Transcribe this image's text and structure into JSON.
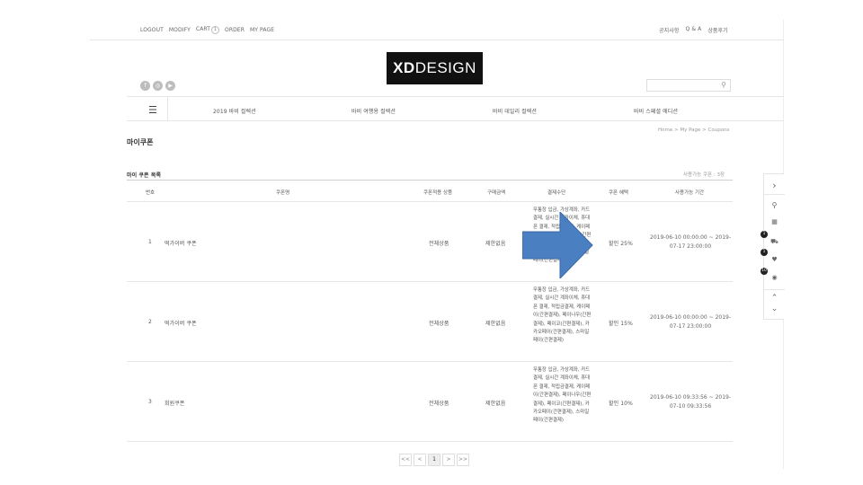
{
  "top_nav": {
    "logout": "LOGOUT",
    "modify": "MODIFY",
    "cart": "CART",
    "cart_count": "1",
    "order": "ORDER",
    "mypage": "MY PAGE"
  },
  "top_right": [
    "공지사항",
    "Q & A",
    "상품후기"
  ],
  "logo": {
    "bold": "XD",
    "light": "DESIGN"
  },
  "social": [
    "f",
    "◎",
    "▶"
  ],
  "categories": [
    "2019 바비 컬렉션",
    "바비 여행용 컬렉션",
    "바비 데일리 컬렉션",
    "바비 스페셜 에디션"
  ],
  "page_title": "마이쿠폰",
  "breadcrumb": "Home  >  My Page  >  Coupons",
  "list_title": "마이 쿠폰 목록",
  "available": "사용가능 쿠폰 : 3장",
  "headers": [
    "번호",
    "쿠폰명",
    "쿠폰적용 상품",
    "구매금액",
    "결제수단",
    "쿠폰 혜택",
    "사용가능 기간"
  ],
  "rows": [
    {
      "no": "1",
      "name": "떡가이버 쿠폰",
      "product": "전체상품",
      "amount": "제한없음",
      "payment": "무통장 입금, 가상계좌, 카드 결제, 실시간 계좌이체, 휴대폰 결제, 적립금결제, 케이페이(간편결제), 페이나우(간편결제), 페이코(간편결제), 카카오페이(간편결제), 스마일페이(간편결제)",
      "benefit": "할인 25%",
      "period": "2019-06-10 00:00:00 ~ 2019-07-17 23:00:00"
    },
    {
      "no": "2",
      "name": "떡가이버 쿠폰",
      "product": "전체상품",
      "amount": "제한없음",
      "payment": "무통장 입금, 가상계좌, 카드 결제, 실시간 계좌이체, 휴대폰 결제, 적립금결제, 케이페이(간편결제), 페이나우(간편결제), 페이코(간편결제), 카카오페이(간편결제), 스마일페이(간편결제)",
      "benefit": "할인 15%",
      "period": "2019-06-10 00:00:00 ~ 2019-07-17 23:00:00"
    },
    {
      "no": "3",
      "name": "회원쿠폰",
      "product": "전체상품",
      "amount": "제한없음",
      "payment": "무통장 입금, 가상계좌, 카드 결제, 실시간 계좌이체, 휴대폰 결제, 적립금결제, 케이페이(간편결제), 페이나우(간편결제), 페이코(간편결제), 카카오페이(간편결제), 스마일페이(간편결제)",
      "benefit": "할인 10%",
      "period": "2019-06-10 09:33:56 ~ 2019-07-10 09:33:56"
    }
  ],
  "rail": {
    "cart_badge": "1",
    "wish_badge": "1",
    "view_badge": "10"
  },
  "pager": [
    "<<",
    "<",
    "1",
    ">",
    ">>"
  ],
  "colors": {
    "arrow": "#4a7fc1",
    "logo_bg": "#111111"
  }
}
